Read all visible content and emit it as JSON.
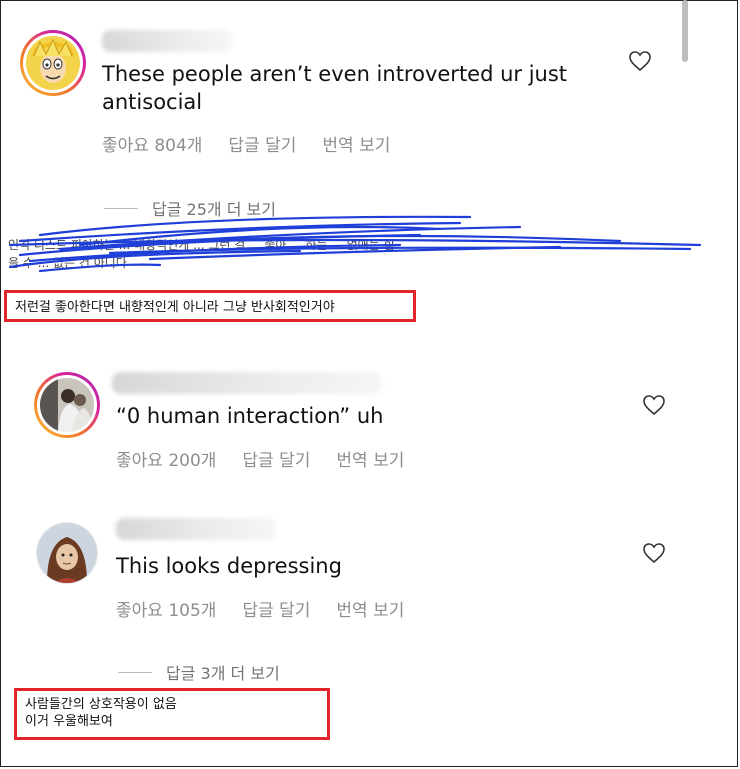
{
  "comments": [
    {
      "text": "These people aren’t even introverted ur just antisocial",
      "likes": "좋아요 804개",
      "reply": "답글 달기",
      "translate": "번역 보기"
    },
    {
      "text": "“0 human interaction” uh",
      "likes": "좋아요 200개",
      "reply": "답글 달기",
      "translate": "번역 보기"
    },
    {
      "text": "This looks depressing",
      "likes": "좋아요 105개",
      "reply": "답글 달기",
      "translate": "번역 보기"
    }
  ],
  "more_replies_1": "답글 25개 더 보기",
  "more_replies_2": "답글 3개 더 보기",
  "scribbled_text_line1": "인격 디스트 피아하는 ... 내향적인게 ... 그런 걸 ... 좋아 ... 하는 ... 없애는 힘",
  "scribbled_text_line2": "을 수 ... 없는 건 아니다",
  "translation_1": "저런걸 좋아한다면 내향적인게 아니라 그냥 반사회적인거야",
  "translation_2_line1": "사람들간의 상호작용이 없음",
  "translation_2_line2": "이거 우울해보여",
  "colors": {
    "meta_gray": "#8e8e8e",
    "annotation_red": "#e0262b",
    "scribble_blue": "#1f3fd8"
  },
  "icons": [
    "heart-icon",
    "avatar"
  ]
}
